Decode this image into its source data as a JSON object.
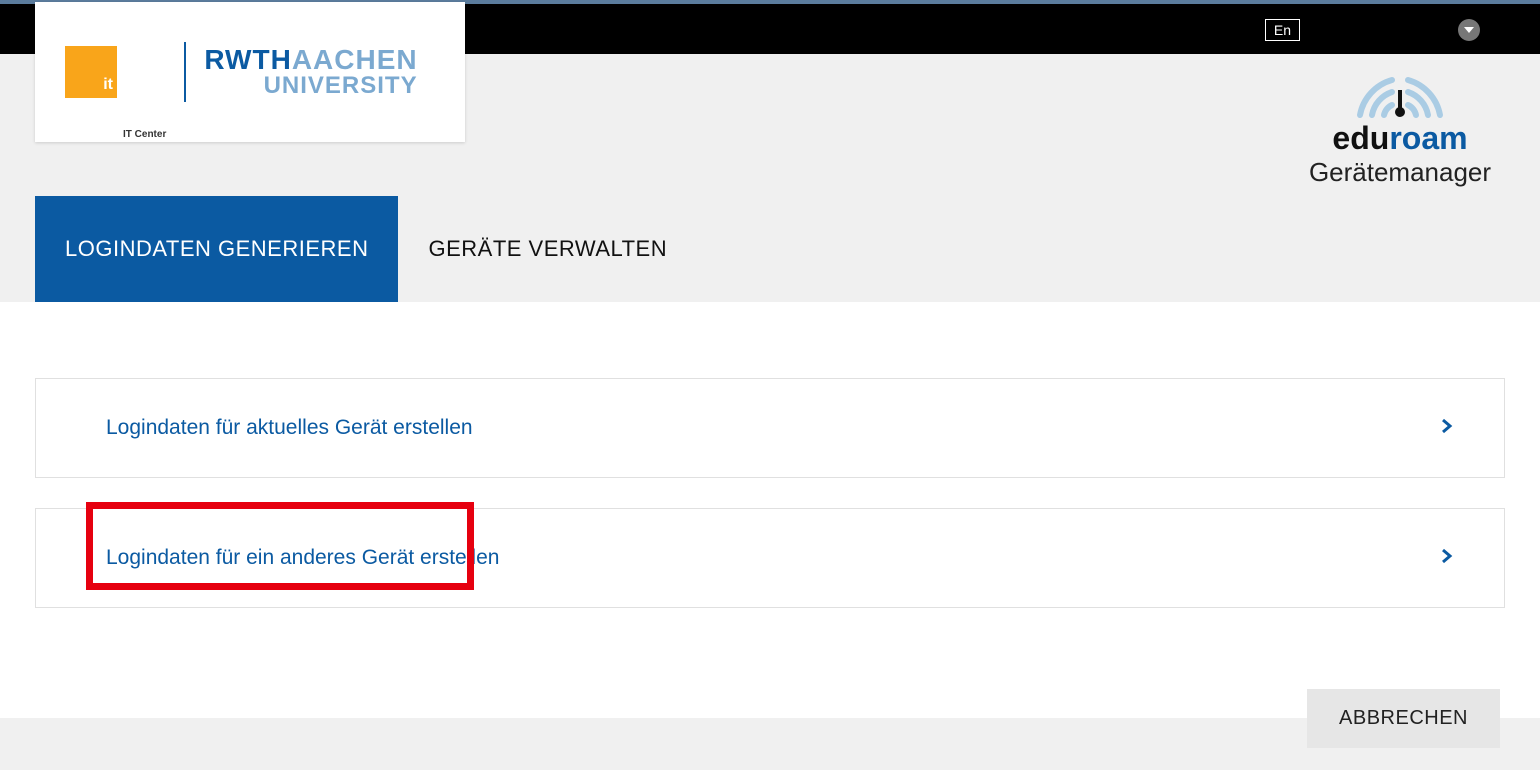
{
  "topbar": {
    "language_toggle": "En"
  },
  "logo": {
    "it_square": "it",
    "it_label": "IT Center",
    "rwth_dark": "RWTH",
    "rwth_light": "AACHEN",
    "university": "UNIVERSITY"
  },
  "branding": {
    "eduroam_edu": "edu",
    "eduroam_roam": "roam",
    "subtitle": "Gerätemanager"
  },
  "tabs": {
    "generate": "LOGINDATEN GENERIEREN",
    "manage": "GERÄTE VERWALTEN"
  },
  "options": {
    "current_device": "Logindaten für aktuelles Gerät erstellen",
    "other_device": "Logindaten für ein anderes Gerät erstellen"
  },
  "buttons": {
    "cancel": "ABBRECHEN"
  }
}
